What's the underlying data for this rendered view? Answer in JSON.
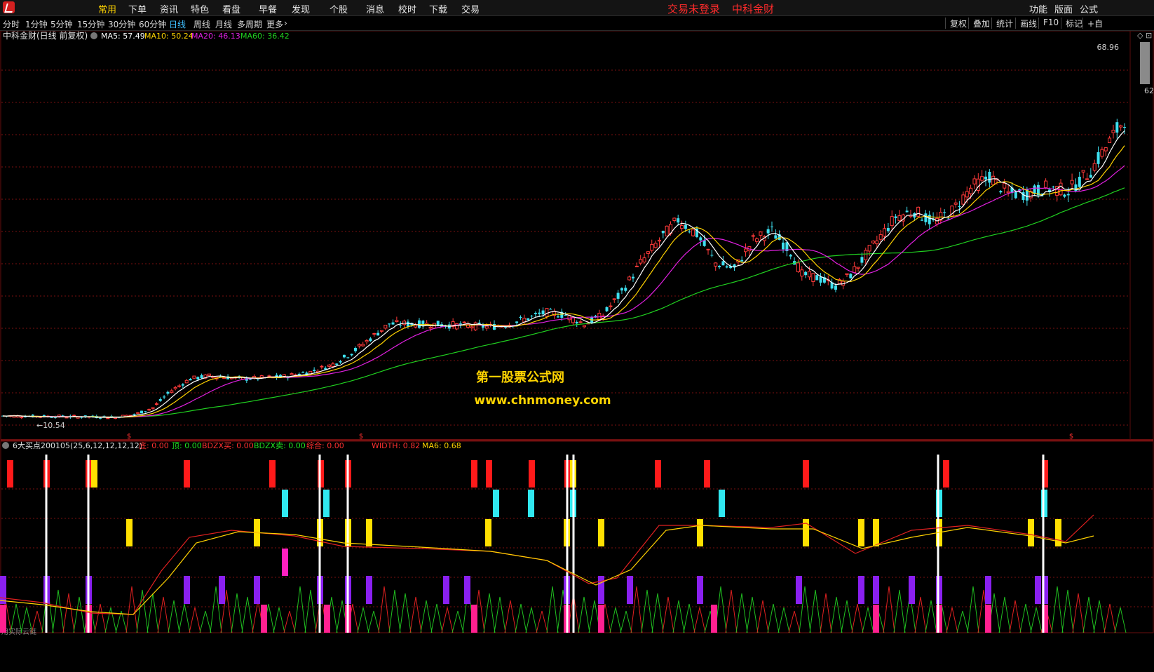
{
  "menubar": {
    "items": [
      "常用",
      "下单",
      "资讯",
      "特色",
      "看盘",
      "早餐",
      "发现",
      "个股",
      "消息",
      "校时",
      "下载",
      "交易"
    ],
    "active_index": 0,
    "login_status": "交易未登录",
    "broker_name": "中科金财",
    "right_items": [
      "功能",
      "版面",
      "公式"
    ]
  },
  "toolbar": {
    "periods": [
      "分时",
      "1分钟",
      "5分钟",
      "15分钟",
      "30分钟",
      "60分钟",
      "日线",
      "周线",
      "月线",
      "多周期",
      "更多"
    ],
    "active_index": 6,
    "right_items": [
      "复权",
      "叠加",
      "统计",
      "画线",
      "F10",
      "标记",
      "+自"
    ]
  },
  "main_chart": {
    "stock_title": "中科金财(日线 前复权)",
    "ma_legend": [
      {
        "label": "MA5: 57.49",
        "color": "#ffffff"
      },
      {
        "label": "MA10: 50.24",
        "color": "#ffd200"
      },
      {
        "label": "MA20: 46.13",
        "color": "#e020e0"
      },
      {
        "label": "MA60: 36.42",
        "color": "#20d020"
      }
    ],
    "price_high_label": "68.96",
    "price_side_label": "62",
    "price_low_label": "10.54",
    "watermark_title": "第一股票公式网",
    "watermark_url": "www.chnmoney.com",
    "marker_glyph": "$"
  },
  "indicator_panel": {
    "title": "6大买点200105(25,6,12,12,12,12)",
    "values": [
      {
        "label": "底: 0.00",
        "color": "#ff3030"
      },
      {
        "label": "顶: 0.00",
        "color": "#20e020"
      },
      {
        "label": "BDZX买: 0.00",
        "color": "#ff3030"
      },
      {
        "label": "BDZX卖: 0.00",
        "color": "#20e020"
      },
      {
        "label": "综合: 0.00",
        "color": "#ff3030"
      },
      {
        "label": "WIDTH: 0.82",
        "color": "#ff3030"
      },
      {
        "label": "MA6: 0.68",
        "color": "#ffd200"
      }
    ],
    "bottom_label": "用实际云链"
  },
  "colors": {
    "up": "#ff3a3a",
    "down": "#3ee0f0",
    "ma5": "#ffffff",
    "ma10": "#ffd200",
    "ma20": "#e020e0",
    "ma60": "#20d020",
    "grid": "#7a1010"
  }
}
